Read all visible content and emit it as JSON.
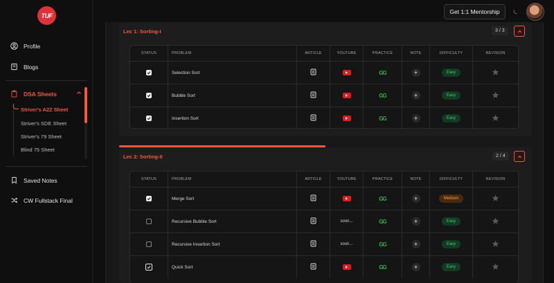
{
  "sidebar": {
    "logo_text": "TUF",
    "profile": "Profile",
    "blogs": "Blogs",
    "dsa_sheets": "DSA Sheets",
    "sheets": [
      "Striver's A2Z Sheet",
      "Striver's SDE Sheet",
      "Striver's 79 Sheet",
      "Blind 75 Sheet"
    ],
    "saved_notes": "Saved Notes",
    "cw_fullstack": "CW Fullstack Final"
  },
  "topbar": {
    "mentorship": "Get 1:1 Mentorship"
  },
  "columns": [
    "STATUS",
    "PROBLEM",
    "ARTICLE",
    "YOUTUBE",
    "PRACTICE",
    "NOTE",
    "DIFFICULTY",
    "REVISION"
  ],
  "sections": [
    {
      "title": "Lec 1: Sorting-I",
      "count": "3 / 3",
      "rows": [
        {
          "problem": "Selection Sort",
          "done": true,
          "youtube": "icon",
          "difficulty": "Easy"
        },
        {
          "problem": "Bubble Sort",
          "done": true,
          "youtube": "icon",
          "difficulty": "Easy"
        },
        {
          "problem": "Insertion Sort",
          "done": true,
          "youtube": "icon",
          "difficulty": "Easy"
        }
      ]
    },
    {
      "title": "Lec 2: Sorting-II",
      "count": "2 / 4",
      "progress": 0.5,
      "rows": [
        {
          "problem": "Merge Sort",
          "done": true,
          "youtube": "icon",
          "difficulty": "Medium"
        },
        {
          "problem": "Recursive Bubble Sort",
          "done": false,
          "youtube": "soon...",
          "difficulty": "Easy"
        },
        {
          "problem": "Recursive Insertion Sort",
          "done": false,
          "youtube": "soon...",
          "difficulty": "Easy"
        },
        {
          "problem": "Quick Sort",
          "done": true,
          "youtube": "icon",
          "difficulty": "Easy"
        }
      ]
    }
  ],
  "practice_glyph": "GG",
  "colors": {
    "accent": "#ef5a3c",
    "youtube": "#e21c1c",
    "gfg": "#2fb344"
  }
}
